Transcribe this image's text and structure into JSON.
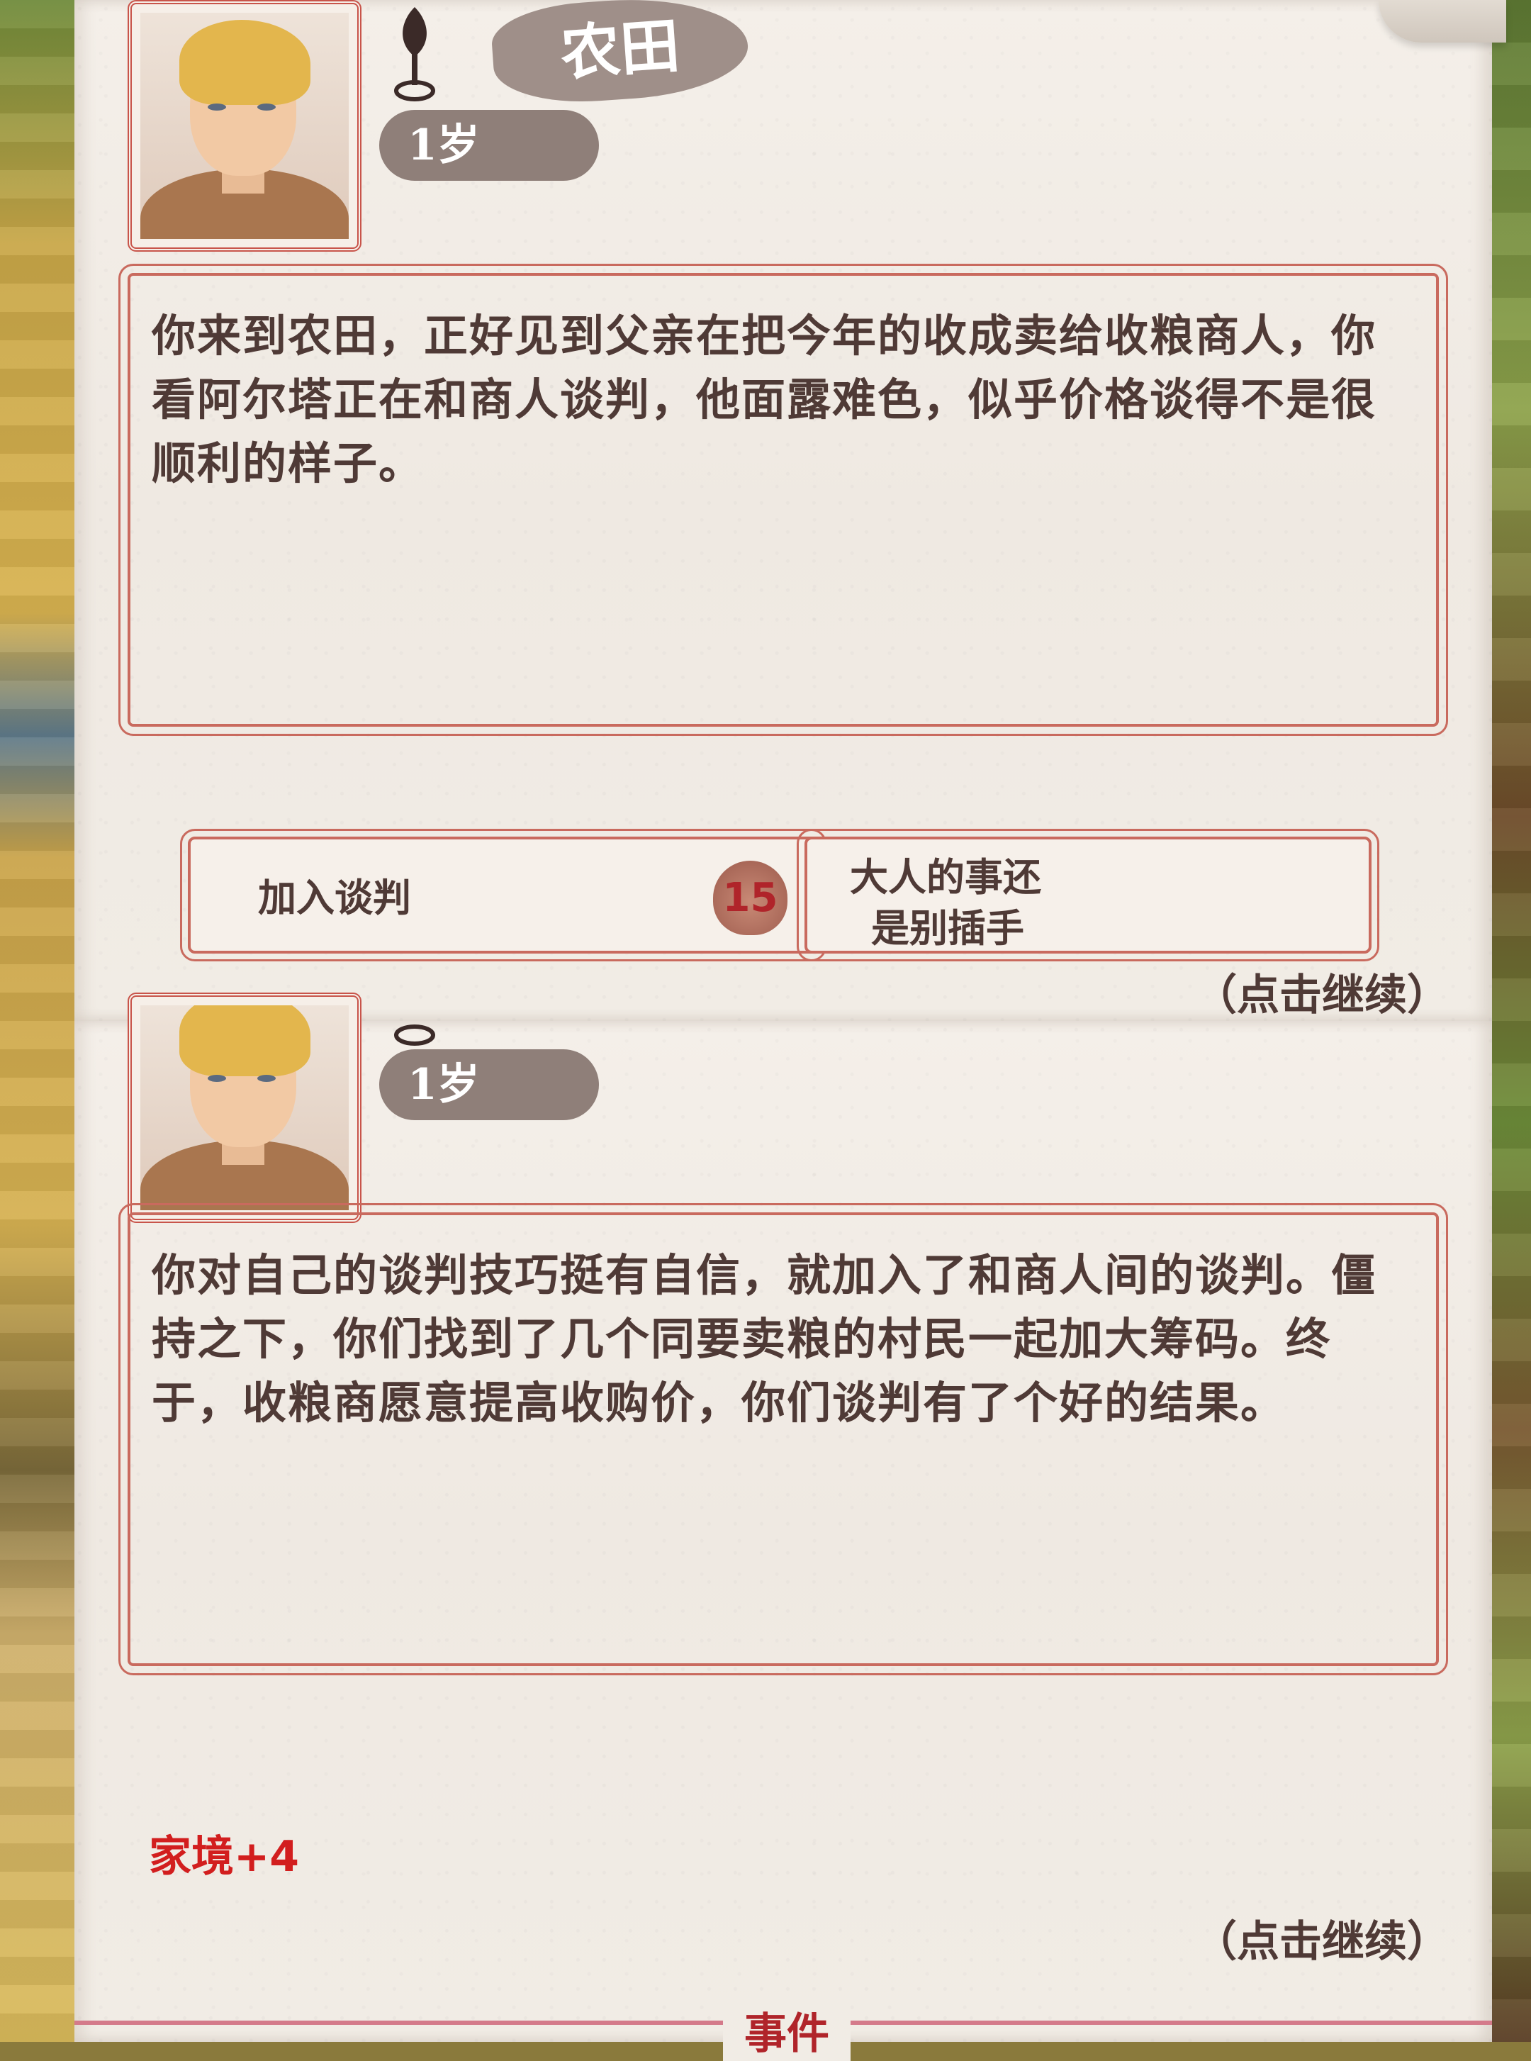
{
  "screen_top": {
    "location_title": "农田",
    "age": "1岁",
    "narrative": "你来到农田，正好见到父亲在把今年的收成卖给收粮商人，你看阿尔塔正在和商人谈判，他面露难色，似乎价格谈得不是很顺利的样子。",
    "choices": [
      {
        "label": "加入谈判",
        "cost": "15"
      },
      {
        "label_line1": "大人的事还",
        "label_line2": "是别插手"
      }
    ],
    "continue_hint": "（点击继续）"
  },
  "screen_bottom": {
    "age": "1岁",
    "narrative": "你对自己的谈判技巧挺有自信，就加入了和商人间的谈判。僵持之下，你们找到了几个同要卖粮的村民一起加大筹码。终于，收粮商愿意提高收购价，你们谈判有了个好的结果。",
    "stat_change": "家境+4",
    "continue_hint": "（点击继续）",
    "section_label": "事件"
  },
  "colors": {
    "paper": "#f1ece5",
    "frame": "#c96a5e",
    "text": "#4f3a36",
    "stat_red": "#d21e1e",
    "pill": "#8f7f79"
  },
  "icons": [
    "sigil-icon",
    "leaf-cost-icon"
  ]
}
